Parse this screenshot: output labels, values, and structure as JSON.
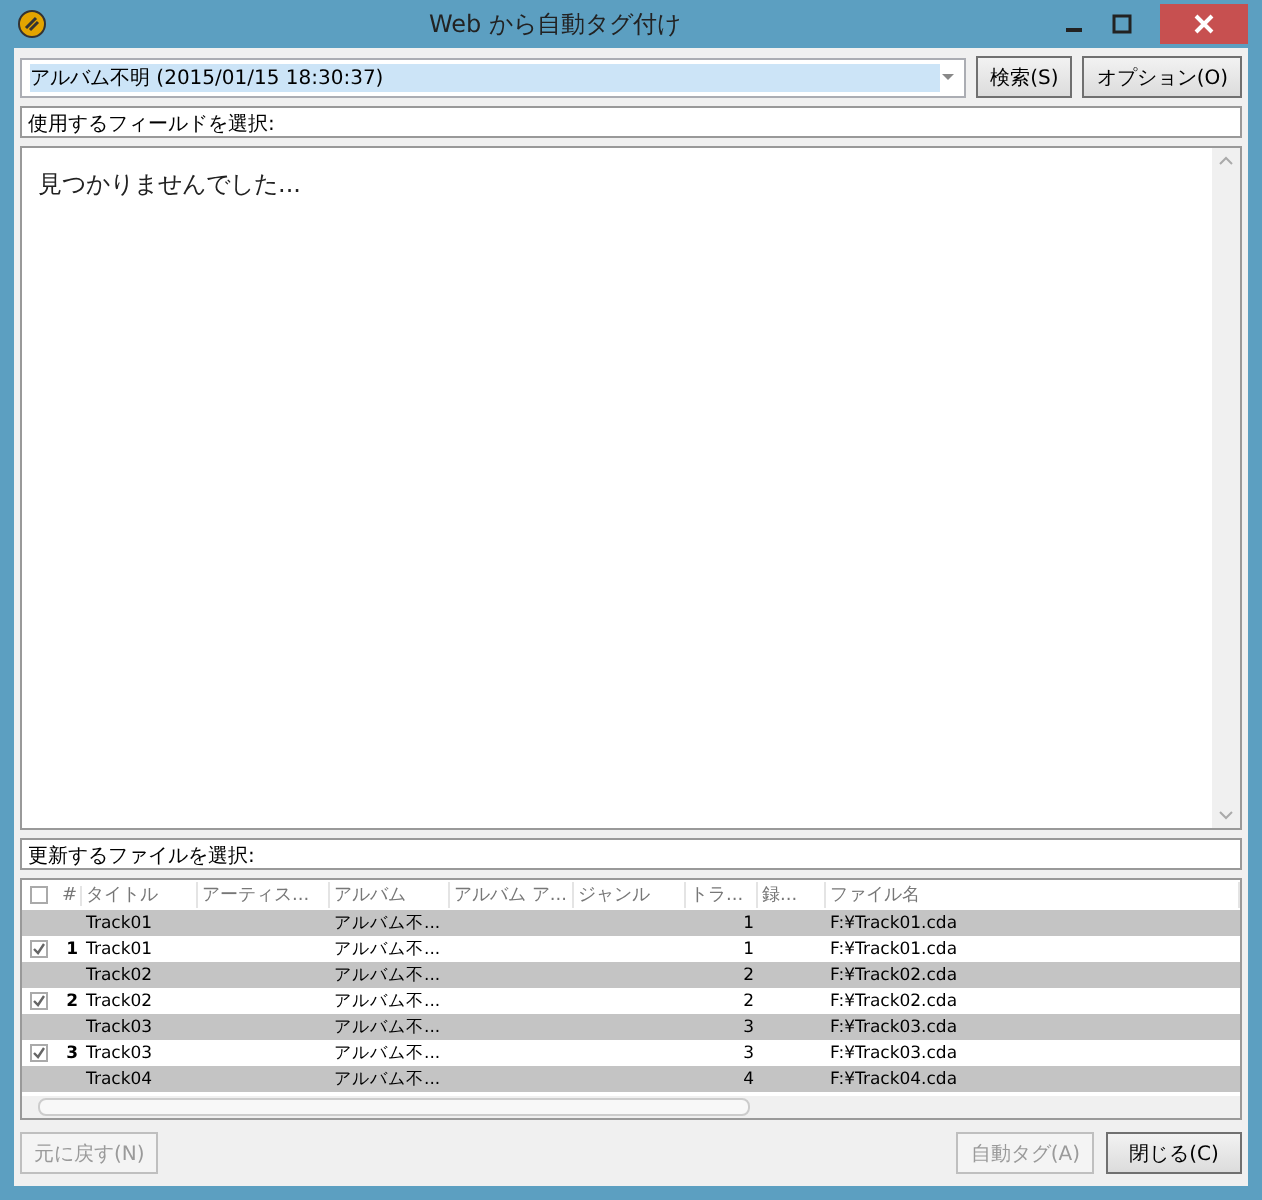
{
  "window": {
    "title": "Web から自動タグ付け"
  },
  "search": {
    "value": "アルバム不明 (2015/01/15 18:30:37)",
    "buttons": [
      "検索(S)",
      "オプション(O)"
    ]
  },
  "fields_label": "使用するフィールドを選択:",
  "results": {
    "message": "見つかりませんでした..."
  },
  "files_label": "更新するファイルを選択:",
  "table": {
    "header_checked": false,
    "columns": [
      "#",
      "タイトル",
      "アーティス...",
      "アルバム",
      "アルバム ア...",
      "ジャンル",
      "トラ...",
      "録...",
      "ファイル名"
    ],
    "rows": [
      {
        "kind": "original",
        "cells": [
          "",
          "Track01",
          "",
          "アルバム不...",
          "",
          "",
          "1",
          "",
          "F:¥Track01.cda"
        ]
      },
      {
        "kind": "match",
        "checked": true,
        "cells": [
          "1",
          "Track01",
          "",
          "アルバム不...",
          "",
          "",
          "1",
          "",
          "F:¥Track01.cda"
        ]
      },
      {
        "kind": "original",
        "cells": [
          "",
          "Track02",
          "",
          "アルバム不...",
          "",
          "",
          "2",
          "",
          "F:¥Track02.cda"
        ]
      },
      {
        "kind": "match",
        "checked": true,
        "cells": [
          "2",
          "Track02",
          "",
          "アルバム不...",
          "",
          "",
          "2",
          "",
          "F:¥Track02.cda"
        ]
      },
      {
        "kind": "original",
        "cells": [
          "",
          "Track03",
          "",
          "アルバム不...",
          "",
          "",
          "3",
          "",
          "F:¥Track03.cda"
        ]
      },
      {
        "kind": "match",
        "checked": true,
        "cells": [
          "3",
          "Track03",
          "",
          "アルバム不...",
          "",
          "",
          "3",
          "",
          "F:¥Track03.cda"
        ]
      },
      {
        "kind": "original",
        "cells": [
          "",
          "Track04",
          "",
          "アルバム不...",
          "",
          "",
          "4",
          "",
          "F:¥Track04.cda"
        ]
      }
    ]
  },
  "buttons": [
    {
      "label": "元に戻す(N)",
      "disabled": true
    },
    {
      "label": "自動タグ(A)",
      "disabled": true
    },
    {
      "label": "閉じる(C)",
      "disabled": false
    }
  ]
}
